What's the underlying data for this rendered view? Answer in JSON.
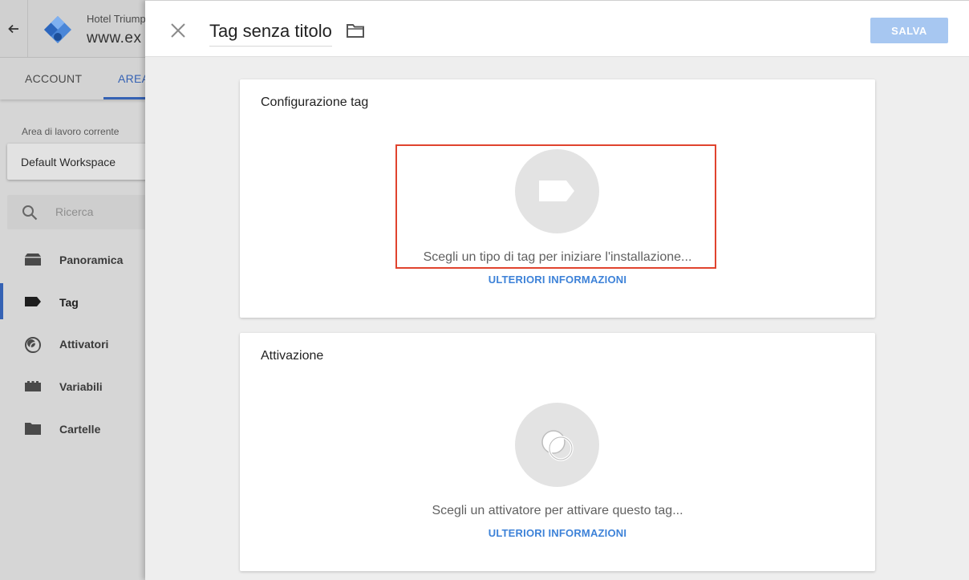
{
  "sidebar": {
    "account_name": "Hotel Triump",
    "container_name": "www.ex",
    "tabs": [
      {
        "label": "ACCOUNT"
      },
      {
        "label": "AREA"
      }
    ],
    "workspace_label": "Area di lavoro corrente",
    "workspace_value": "Default Workspace",
    "search_placeholder": "Ricerca",
    "nav": [
      {
        "label": "Panoramica",
        "icon": "overview-icon"
      },
      {
        "label": "Tag",
        "icon": "tag-icon",
        "active": true
      },
      {
        "label": "Attivatori",
        "icon": "trigger-icon"
      },
      {
        "label": "Variabili",
        "icon": "variables-icon"
      },
      {
        "label": "Cartelle",
        "icon": "folder-icon"
      }
    ]
  },
  "editor": {
    "title": "Tag senza titolo",
    "save_label": "SALVA",
    "config_card": {
      "title": "Configurazione tag",
      "prompt": "Scegli un tipo di tag per iniziare l'installazione...",
      "link": "ULTERIORI INFORMAZIONI"
    },
    "trigger_card": {
      "title": "Attivazione",
      "prompt": "Scegli un attivatore per attivare questo tag...",
      "link": "ULTERIORI INFORMAZIONI"
    }
  },
  "colors": {
    "accent": "#3562b4",
    "link": "#3d82d8",
    "save_button_disabled": "#a7c7f1",
    "highlight": "#e0432e"
  }
}
